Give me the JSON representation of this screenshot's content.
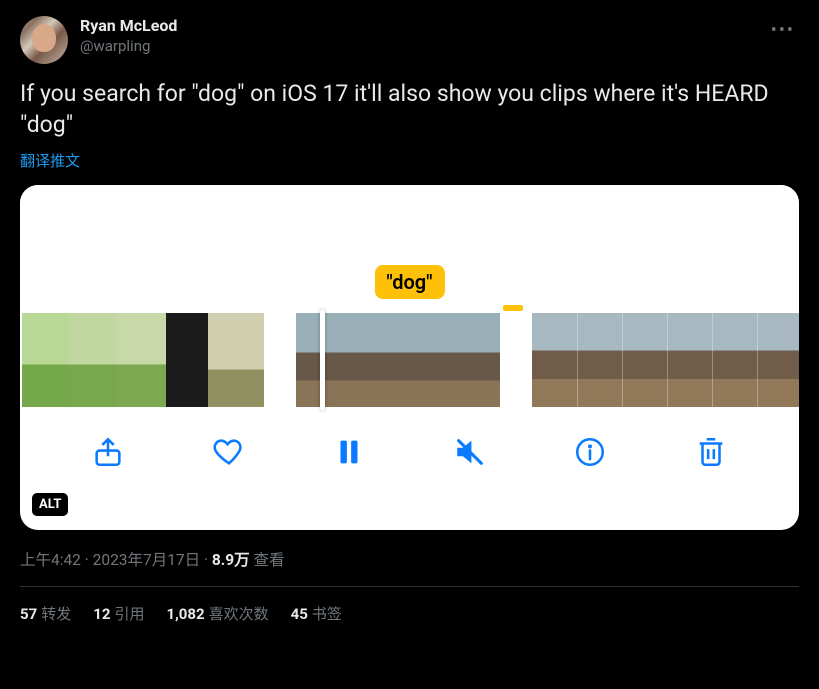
{
  "user": {
    "display_name": "Ryan McLeod",
    "handle": "@warpling"
  },
  "tweet_text": "If you search for \"dog\" on iOS 17 it'll also show you clips where it's HEARD \"dog\"",
  "translate_label": "翻译推文",
  "media": {
    "search_token": "\"dog\"",
    "alt_badge": "ALT"
  },
  "meta": {
    "time": "上午4:42",
    "date": "2023年7月17日",
    "views_count": "8.9万",
    "views_label": "查看"
  },
  "stats": {
    "retweets_count": "57",
    "retweets_label": "转发",
    "quotes_count": "12",
    "quotes_label": "引用",
    "likes_count": "1,082",
    "likes_label": "喜欢次数",
    "bookmarks_count": "45",
    "bookmarks_label": "书签"
  }
}
